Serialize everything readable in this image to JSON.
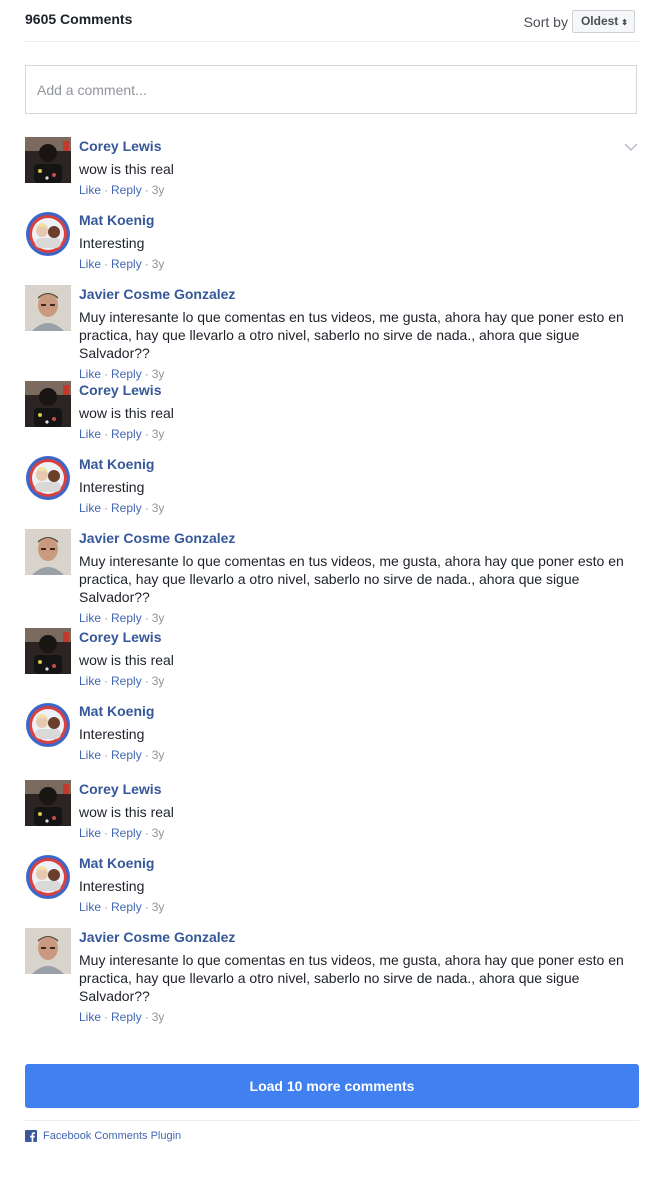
{
  "header": {
    "count_label": "9605 Comments",
    "sort_label": "Sort by",
    "sort_value": "Oldest"
  },
  "composer": {
    "placeholder": "Add a comment..."
  },
  "actions": {
    "like": "Like",
    "reply": "Reply",
    "separator": "·"
  },
  "comments": [
    {
      "author": "Corey Lewis",
      "text": "wow is this real",
      "time": "3y",
      "avatar": "corey"
    },
    {
      "author": "Mat Koenig",
      "text": "Interesting",
      "time": "3y",
      "avatar": "mat"
    },
    {
      "author": "Javier Cosme Gonzalez",
      "text": "Muy interesante lo que comentas en tus videos, me gusta, ahora hay que poner esto en practica, hay que llevarlo a otro nivel, saberlo no sirve de nada., ahora que sigue Salvador??",
      "time": "3y",
      "avatar": "javier"
    },
    {
      "author": "Corey Lewis",
      "text": "wow is this real",
      "time": "3y",
      "avatar": "corey"
    },
    {
      "author": "Mat Koenig",
      "text": "Interesting",
      "time": "3y",
      "avatar": "mat"
    },
    {
      "author": "Javier Cosme Gonzalez",
      "text": "Muy interesante lo que comentas en tus videos, me gusta, ahora hay que poner esto en practica, hay que llevarlo a otro nivel, saberlo no sirve de nada., ahora que sigue Salvador??",
      "time": "3y",
      "avatar": "javier"
    },
    {
      "author": "Corey Lewis",
      "text": "wow is this real",
      "time": "3y",
      "avatar": "corey"
    },
    {
      "author": "Mat Koenig",
      "text": "Interesting",
      "time": "3y",
      "avatar": "mat"
    },
    {
      "author": "Corey Lewis",
      "text": "wow is this real",
      "time": "3y",
      "avatar": "corey"
    },
    {
      "author": "Mat Koenig",
      "text": "Interesting",
      "time": "3y",
      "avatar": "mat"
    },
    {
      "author": "Javier Cosme Gonzalez",
      "text": "Muy interesante lo que comentas en tus videos, me gusta, ahora hay que poner esto en practica, hay que llevarlo a otro nivel, saberlo no sirve de nada., ahora que sigue Salvador??",
      "time": "3y",
      "avatar": "javier"
    }
  ],
  "load_more_label": "Load 10 more comments",
  "footer": {
    "plugin_label": "Facebook Comments Plugin",
    "icon": "facebook-icon"
  },
  "colors": {
    "link": "#365899",
    "action_link": "#4267b2",
    "button": "#4080f0"
  }
}
